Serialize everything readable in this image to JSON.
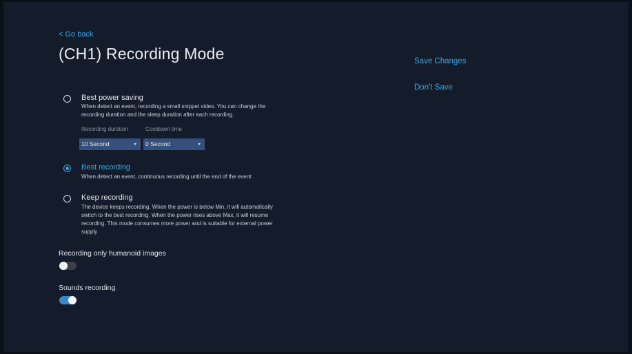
{
  "header": {
    "back_label": "< Go back",
    "title": "(CH1)  Recording Mode"
  },
  "actions": {
    "save_label": "Save Changes",
    "dont_save_label": "Don't Save"
  },
  "recording_modes": {
    "selected": "Best recording",
    "options": [
      {
        "title": "Best power saving",
        "description": "When detect an event, recording a small snippet video. You can change the recording duration and the sleep duration after each recording.",
        "selected": false
      },
      {
        "title": "Best recording",
        "description": "When detect an event, continuous recording until the end of the event",
        "selected": true
      },
      {
        "title": "Keep recording",
        "description": "The device keeps recording. When the power is below Min, it will automatically switch to the best recording. When the power rises above Max, it will resume recording. This mode consumes more power and is suitable for external power supply",
        "selected": false
      }
    ],
    "recording_duration": {
      "label": "Recording duration",
      "value": "10 Second"
    },
    "cooldown_time": {
      "label": "Cooldown time",
      "value": "0 Second"
    }
  },
  "humanoid": {
    "label": "Recording only humanoid images",
    "enabled": false
  },
  "sounds": {
    "label": "Sounds recording",
    "enabled": true
  },
  "colors": {
    "accent": "#3fa6e3",
    "background": "#141c2b",
    "select_bg": "#35507a",
    "toggle_on": "#3a86c8"
  }
}
